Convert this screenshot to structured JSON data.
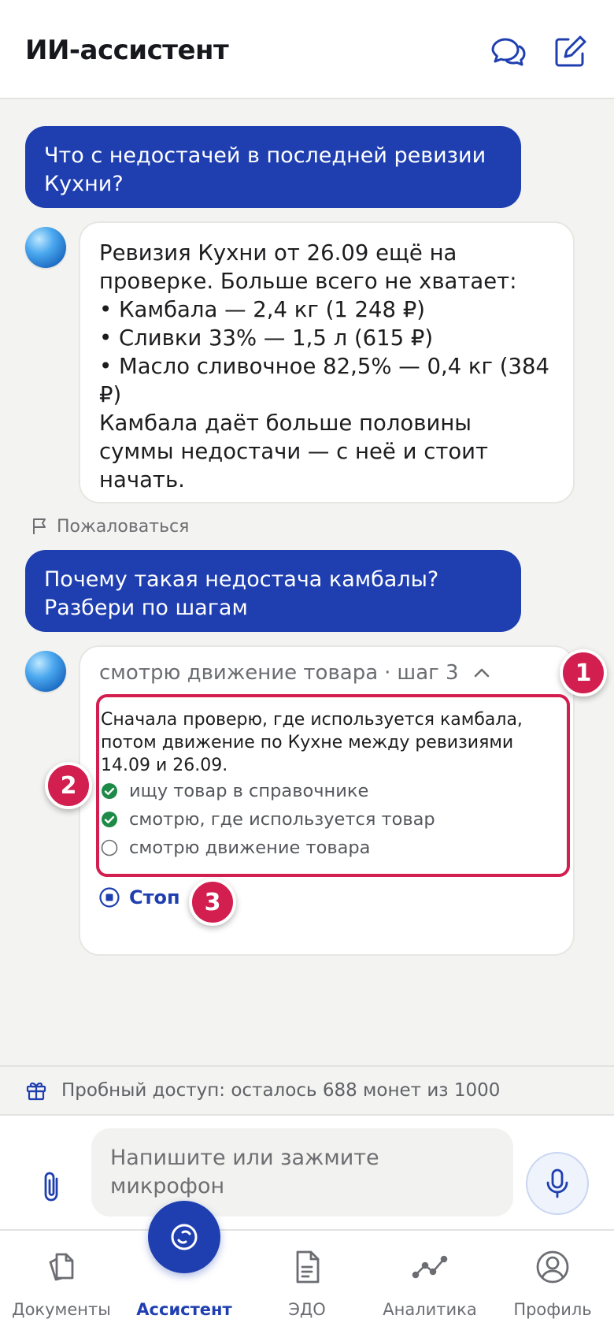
{
  "header": {
    "title": "ИИ-ассистент",
    "icons": [
      "chat-bubbles-icon",
      "compose-icon"
    ]
  },
  "messages": {
    "user_1": {
      "lines": [
        "Что с недостачей в последней ревизии",
        "Кухни?"
      ]
    },
    "bot_1": {
      "lines": [
        "Ревизия Кухни от 26.09 ещё на",
        "проверке. Больше всего не хватает:",
        "• Камбала — 2,4 кг (1 248 ₽)",
        "• Сливки 33% — 1,5 л (615 ₽)",
        "• Масло сливочное 82,5% — 0,4 кг (384",
        "₽)",
        "Камбала даёт больше половины",
        "суммы недостачи — с неё и стоит",
        "начать."
      ],
      "report_label": "Пожаловаться"
    },
    "user_2": {
      "lines": [
        "Почему такая недостача камбалы?",
        "Разбери по шагам"
      ]
    },
    "bot_2": {
      "thinking_status": "смотрю движение товара",
      "thinking_separator": "·",
      "thinking_step": "шаг 3",
      "intro_lines": [
        "Сначала проверю, где используется камбала,",
        "потом движение по Кухне между ревизиями",
        "14.09 и 26.09."
      ],
      "steps": [
        {
          "label": "ищу товар в справочнике",
          "done": true
        },
        {
          "label": "смотрю, где используется товар",
          "done": true
        },
        {
          "label": "смотрю движение товара",
          "done": false
        }
      ],
      "stop_label": "Стоп"
    }
  },
  "badges": [
    "1",
    "2",
    "3"
  ],
  "trial": {
    "text": "Пробный доступ: осталось 688 монет из 1000",
    "icon": "gift-icon"
  },
  "composer": {
    "placeholder_lines": [
      "Напишите или зажмите",
      "микрофон"
    ],
    "icons": [
      "paperclip-icon",
      "microphone-icon"
    ]
  },
  "tabs": [
    {
      "label": "Документы",
      "icon": "documents-icon",
      "active": false
    },
    {
      "label": "Ассистент",
      "icon": "assistant-icon",
      "active": true
    },
    {
      "label": "ЭДО",
      "icon": "edo-document-icon",
      "active": false
    },
    {
      "label": "Аналитика",
      "icon": "analytics-chart-icon",
      "active": false
    },
    {
      "label": "Профиль",
      "icon": "profile-icon",
      "active": false
    }
  ],
  "colors": {
    "accent": "#1f3fb0",
    "highlight": "#d21f4f",
    "success": "#1e8a47",
    "background": "#f3f3f1"
  }
}
